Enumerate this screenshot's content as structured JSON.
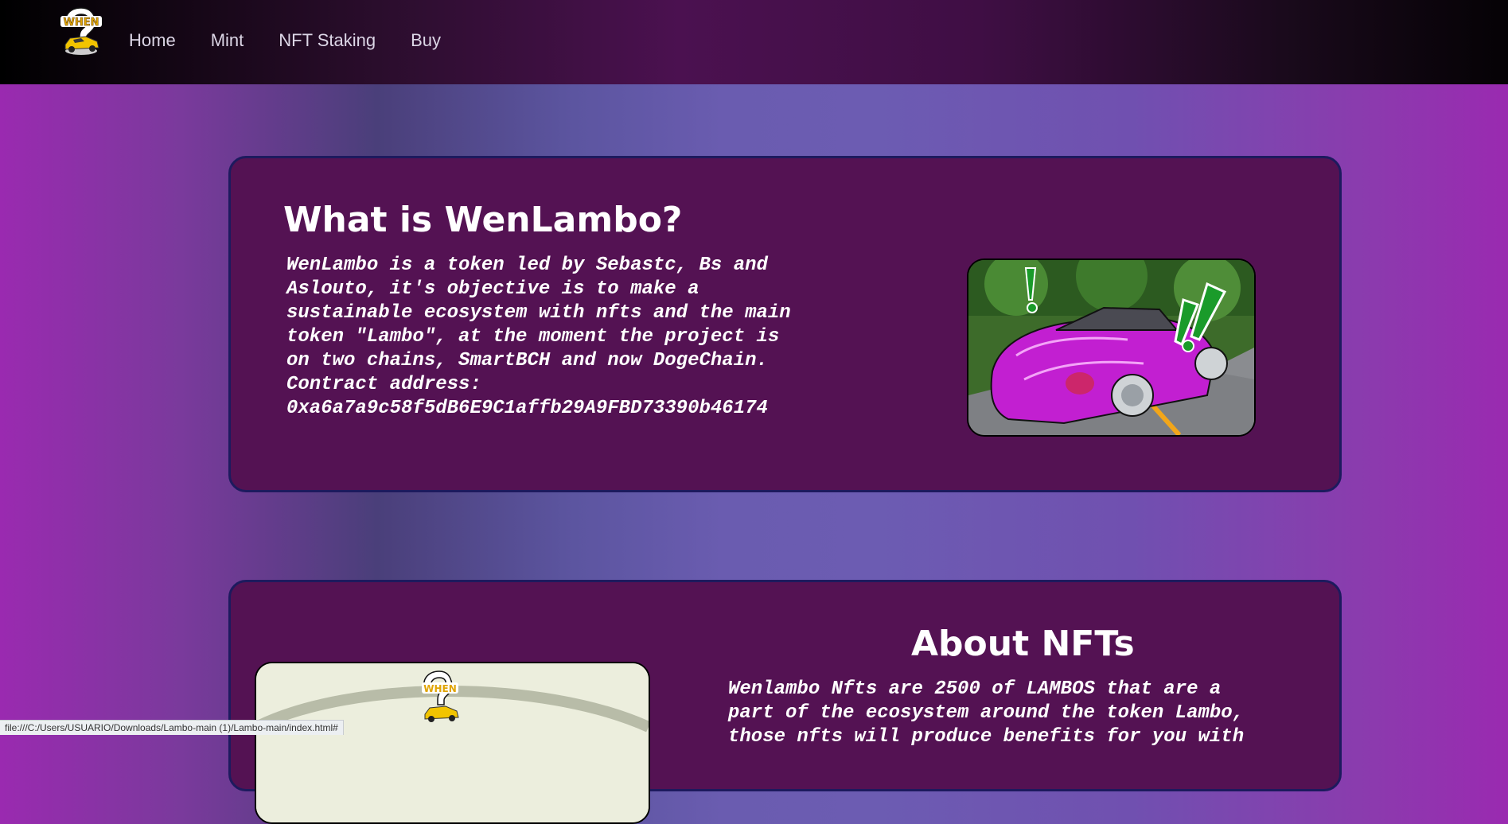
{
  "nav": {
    "logo_text": "WHEN",
    "links": [
      "Home",
      "Mint",
      "NFT Staking",
      "Buy"
    ]
  },
  "section_what": {
    "title": "What is WenLambo?",
    "lines": [
      "WenLambo is a token led by Sebastc, Bs and",
      "Aslouto, it's objective is to make a",
      "sustainable ecosystem with nfts and the main",
      "token \"Lambo\", at the moment the project is",
      "on two chains, SmartBCH and now DogeChain.",
      "Contract address:",
      "0xa6a7a9c58f5dB6E9C1affb29A9FBD73390b46174"
    ]
  },
  "section_nfts": {
    "title": "About NFTs",
    "lines": [
      "Wenlambo Nfts are 2500 of LAMBOS that are a",
      "part of the ecosystem around the token Lambo,",
      "those nfts will produce benefits for you with"
    ],
    "image_logo_text": "WHEN"
  },
  "status_bar": {
    "url": "file:///C:/Users/USUARIO/Downloads/Lambo-main (1)/Lambo-main/index.html#"
  },
  "colors": {
    "card_bg": "#541253",
    "card_border": "#1d1a5e",
    "accent_purple": "#c21fd1",
    "accent_green": "#1a9b2a"
  }
}
